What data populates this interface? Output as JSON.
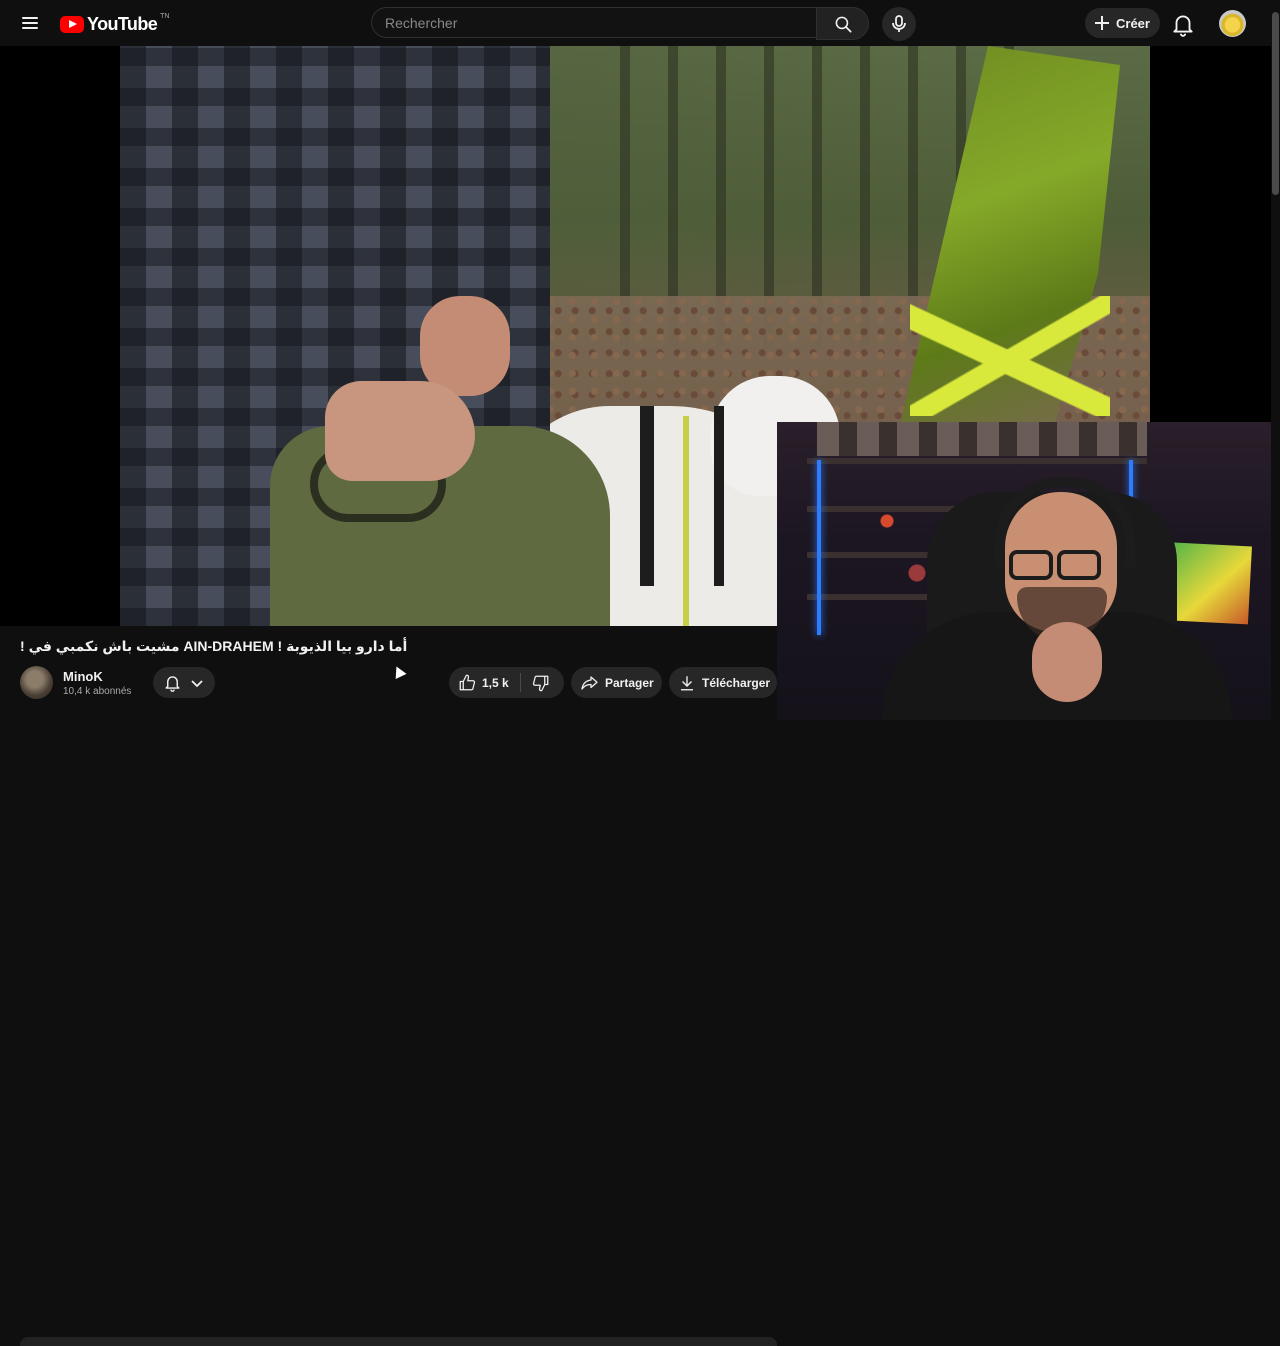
{
  "header": {
    "logo_text": "YouTube",
    "logo_region": "TN",
    "search_placeholder": "Rechercher",
    "create_label": "Créer",
    "icons": [
      "menu-icon",
      "youtube-logo",
      "search-icon",
      "microphone-icon",
      "plus-icon",
      "bell-icon",
      "avatar"
    ]
  },
  "video": {
    "title": "! مشيت باش نكمبي في AIN-DRAHEM ! أما دارو بيا الذيوبة"
  },
  "channel": {
    "name": "MinoK",
    "subscribers": "10,4 k abonnés"
  },
  "actions": {
    "like_count": "1,5 k",
    "share_label": "Partager",
    "download_label": "Télécharger"
  },
  "colors": {
    "background": "#0f0f0f",
    "pill": "#272727",
    "brand_red": "#ff0000",
    "text": "#f1f1f1",
    "secondary_text": "#aaaaaa"
  }
}
